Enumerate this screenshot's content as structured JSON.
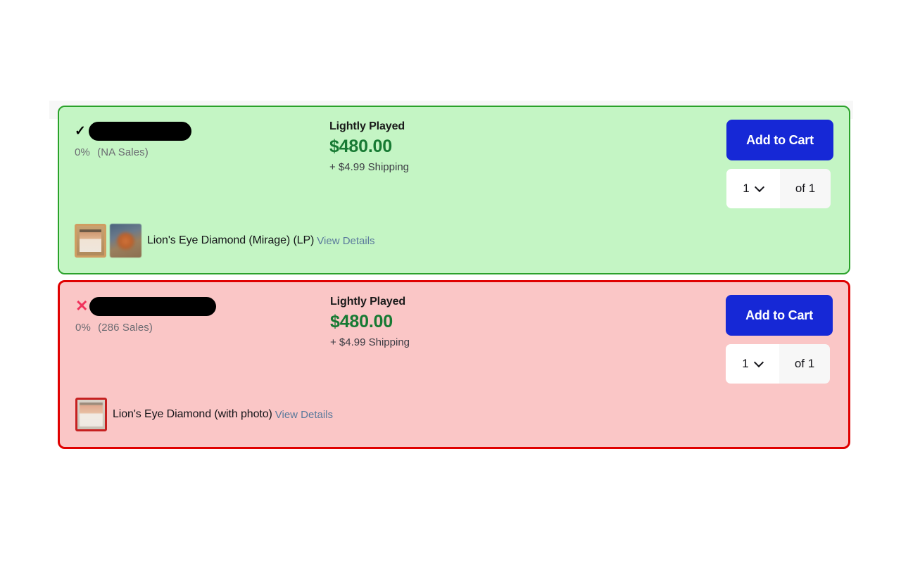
{
  "listings": [
    {
      "status_icon": "check-icon",
      "status_glyph": "✓",
      "seller_name_redacted": "",
      "rating_pct": "0%",
      "sales_count": "(NA Sales)",
      "condition": "Lightly Played",
      "price": "$480.00",
      "shipping": "+ $4.99 Shipping",
      "add_to_cart_label": "Add to Cart",
      "qty_value": "1",
      "qty_total_label": "of 1",
      "product_name": "Lion's Eye Diamond (Mirage) (LP)",
      "view_details_label": "View Details",
      "accent_border": "#2aa22a",
      "accent_bg": "#c4f5c4",
      "thumbnails": [
        "card-front-thumbnail",
        "card-photo-thumbnail"
      ]
    },
    {
      "status_icon": "cross-icon",
      "status_glyph": "✕",
      "seller_name_redacted": "",
      "rating_pct": "0%",
      "sales_count": "(286 Sales)",
      "condition": "Lightly Played",
      "price": "$480.00",
      "shipping": "+ $4.99 Shipping",
      "add_to_cart_label": "Add to Cart",
      "qty_value": "1",
      "qty_total_label": "of 1",
      "product_name": "Lion's Eye Diamond (with photo)",
      "view_details_label": "View Details",
      "accent_border": "#e00000",
      "accent_bg": "#fac6c6",
      "thumbnails": [
        "card-redborder-thumbnail"
      ]
    }
  ],
  "colors": {
    "price_green": "#177a33",
    "add_to_cart_blue": "#1628d6",
    "link_blue": "#5b7a9c",
    "muted_text": "#6b6b72",
    "cross_red": "#f0325c",
    "backdrop_gray": "#f7f7f7"
  }
}
